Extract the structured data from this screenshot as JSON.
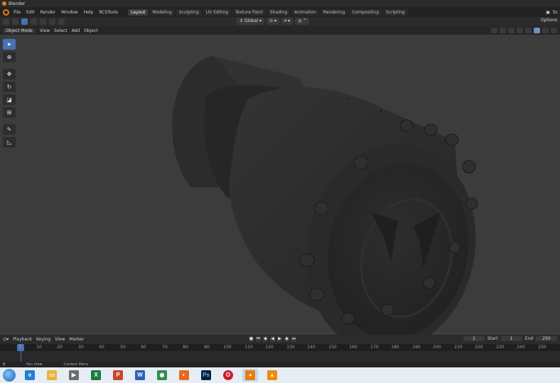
{
  "window": {
    "title": "Blender"
  },
  "menu": {
    "items": [
      "File",
      "Edit",
      "Render",
      "Window",
      "Help",
      "RCSTools"
    ],
    "workspaces": [
      "Layout",
      "Modeling",
      "Sculpting",
      "UV Editing",
      "Texture Paint",
      "Shading",
      "Animation",
      "Rendering",
      "Compositing",
      "Scripting"
    ],
    "active_workspace": "Layout",
    "right_label": "Sc"
  },
  "tool_header": {
    "orientation": "Global",
    "options_label": "Options"
  },
  "viewport_header": {
    "mode": "Object Mode",
    "menus": [
      "View",
      "Select",
      "Add",
      "Object"
    ]
  },
  "tools": [
    "select-box",
    "cursor",
    "move",
    "rotate",
    "scale",
    "transform",
    "annotate",
    "measure"
  ],
  "timeline": {
    "menus": [
      "Playback",
      "Keying",
      "View",
      "Marker"
    ],
    "current_frame": "1",
    "start_label": "Start",
    "start_value": "1",
    "end_label": "End",
    "end_value": "250",
    "ruler_ticks": [
      "10",
      "20",
      "30",
      "40",
      "50",
      "60",
      "70",
      "80",
      "90",
      "100",
      "110",
      "120",
      "130",
      "140",
      "150",
      "160",
      "170",
      "180",
      "190",
      "200",
      "210",
      "220",
      "230",
      "240",
      "250"
    ],
    "cursor_label": "1"
  },
  "status": {
    "left": "Pan View",
    "middle": "Context Menu"
  },
  "taskbar": {
    "apps": [
      {
        "name": "internet-explorer",
        "glyph": "e",
        "color": "#1e7fd6"
      },
      {
        "name": "file-explorer",
        "glyph": "▭",
        "color": "#e8b43a"
      },
      {
        "name": "media-player",
        "glyph": "▶",
        "color": "#6d6d6d"
      },
      {
        "name": "excel",
        "glyph": "X",
        "color": "#1d7a45"
      },
      {
        "name": "powerpoint",
        "glyph": "P",
        "color": "#c8452a"
      },
      {
        "name": "word",
        "glyph": "W",
        "color": "#2b5fb4"
      },
      {
        "name": "network",
        "glyph": "◉",
        "color": "#2f8f4a"
      },
      {
        "name": "firefox",
        "glyph": "◐",
        "color": "#e86a1a"
      },
      {
        "name": "photoshop",
        "glyph": "Ps",
        "color": "#0b1f3d"
      },
      {
        "name": "opera",
        "glyph": "O",
        "color": "#d11a2a"
      },
      {
        "name": "blender",
        "glyph": "◕",
        "color": "#e87d0d"
      },
      {
        "name": "vlc",
        "glyph": "▲",
        "color": "#f08a0c"
      }
    ]
  }
}
